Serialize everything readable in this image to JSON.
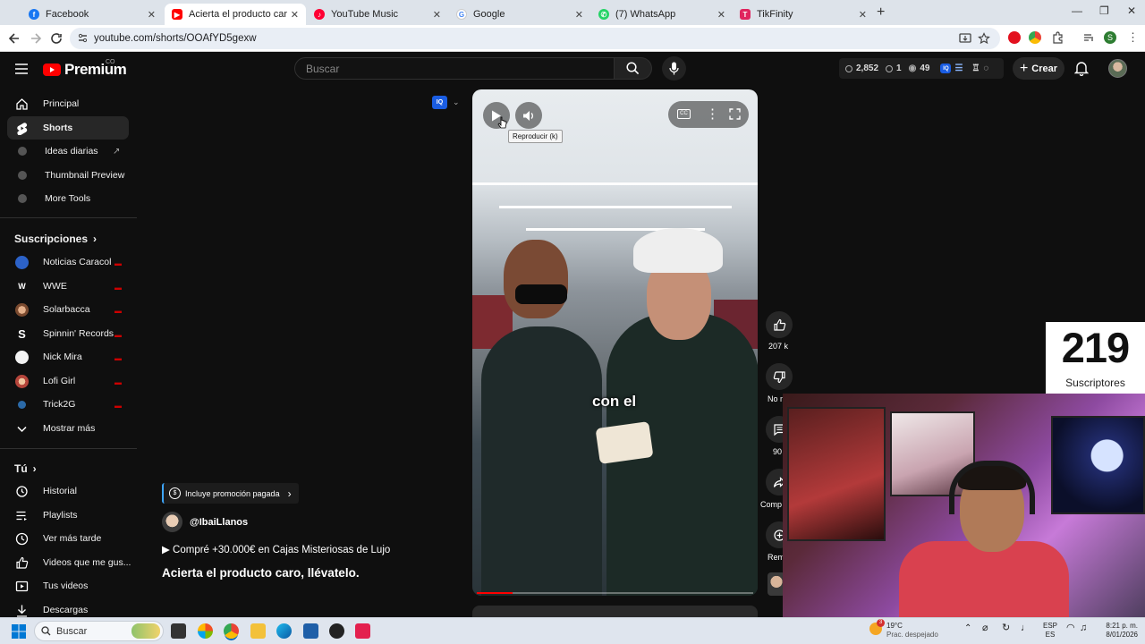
{
  "browser": {
    "tabs": [
      {
        "title": "Facebook",
        "color": "#1877f2",
        "glyph": "f"
      },
      {
        "title": "Acierta el producto caro, llévatelo",
        "color": "#ff0000",
        "glyph": "▶"
      },
      {
        "title": "YouTube Music",
        "color": "#ff0033",
        "glyph": "♪"
      },
      {
        "title": "Google",
        "color": "#4285f4",
        "glyph": "G"
      },
      {
        "title": "(7) WhatsApp",
        "color": "#25d366",
        "glyph": "✆"
      },
      {
        "title": "TikFinity",
        "color": "#e0245e",
        "glyph": "T"
      }
    ],
    "url": "youtube.com/shorts/OOAfYD5gexw"
  },
  "masthead": {
    "logo_text": "Premium",
    "country_code": "CO",
    "search_placeholder": "Buscar",
    "stats": {
      "views": "2,852",
      "a": "1",
      "b": "49"
    },
    "create_label": "Crear"
  },
  "sidebar": {
    "main": [
      {
        "label": "Principal",
        "icon": "home-icon"
      },
      {
        "label": "Shorts",
        "icon": "shorts-icon",
        "active": true
      },
      {
        "label": "Ideas diarias",
        "icon": "iq-icon"
      },
      {
        "label": "Thumbnail Preview",
        "icon": "iq-icon"
      },
      {
        "label": "More Tools",
        "icon": "iq-icon"
      }
    ],
    "subs_heading": "Suscripciones",
    "subs": [
      {
        "label": "Noticias Caracol",
        "color": "#2c62c8"
      },
      {
        "label": "WWE",
        "color": "#111111"
      },
      {
        "label": "Solarbacca",
        "color": "#c0703a"
      },
      {
        "label": "Spinnin' Records",
        "color": "#0f0f0f"
      },
      {
        "label": "Nick Mira",
        "color": "#f2f2f2"
      },
      {
        "label": "Lofi Girl",
        "color": "#b5453b"
      },
      {
        "label": "Trick2G",
        "color": "#2b6aa8"
      }
    ],
    "show_more": "Mostrar más",
    "you_heading": "Tú",
    "you": [
      {
        "label": "Historial",
        "icon": "history-icon"
      },
      {
        "label": "Playlists",
        "icon": "playlists-icon"
      },
      {
        "label": "Ver más tarde",
        "icon": "clock-icon"
      },
      {
        "label": "Videos que me gus...",
        "icon": "like-icon"
      },
      {
        "label": "Tus videos",
        "icon": "video-icon"
      },
      {
        "label": "Descargas",
        "icon": "download-icon"
      }
    ]
  },
  "short": {
    "tooltip": "Reproducir (k)",
    "caption": "con el",
    "promo": "Incluye promoción pagada",
    "channel": "@IbaiLlanos",
    "line": "▶ Compré +30.000€ en Cajas Misteriosas de Lujo",
    "title": "Acierta el producto caro, llévatelo.",
    "progress": 0.13,
    "actions": {
      "likes": "207 k",
      "dislike": "No m",
      "comments": "90",
      "share": "Comp",
      "remix": "Rem"
    }
  },
  "overlay": {
    "subscriber_count": "219",
    "subscriber_label": "Suscriptores"
  },
  "taskbar": {
    "search": "Buscar",
    "weather_temp": "19°C",
    "weather_desc": "Prac. despejado",
    "weather_badge": "3",
    "lang_top": "ESP",
    "lang_bottom": "ES",
    "time": "8:21 p. m.",
    "date": "8/01/2026"
  }
}
